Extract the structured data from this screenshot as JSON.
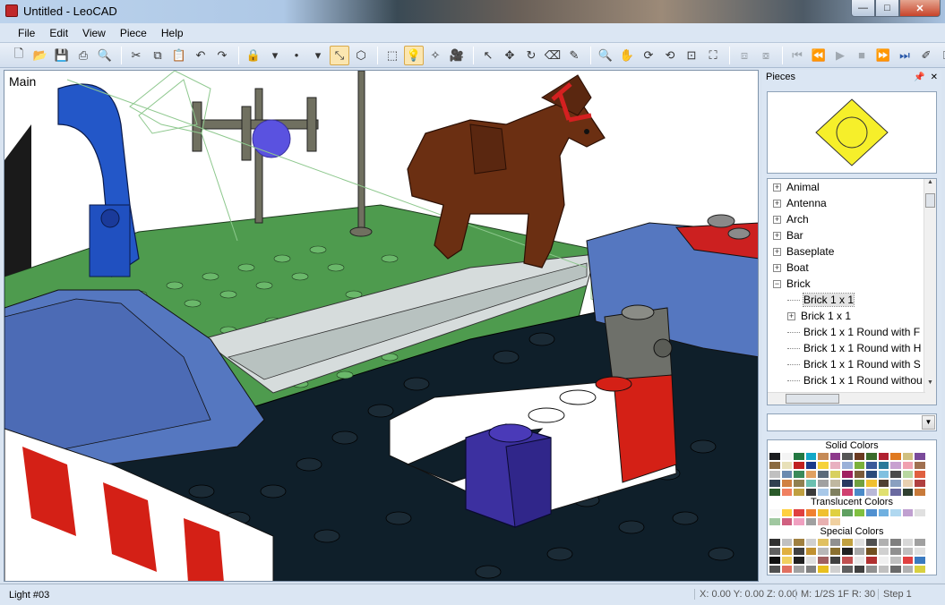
{
  "window": {
    "title": "Untitled - LeoCAD",
    "buttons": {
      "minimize": "—",
      "maximize": "□",
      "close": "✕"
    }
  },
  "menu": [
    {
      "label": "File"
    },
    {
      "label": "Edit"
    },
    {
      "label": "View"
    },
    {
      "label": "Piece"
    },
    {
      "label": "Help"
    }
  ],
  "toolbar": {
    "groups": [
      [
        {
          "icon": "new-file-icon",
          "glyph": "🗋"
        },
        {
          "icon": "open-folder-icon",
          "glyph": "📂"
        },
        {
          "icon": "save-icon",
          "glyph": "💾"
        },
        {
          "icon": "print-icon",
          "glyph": "⎙"
        },
        {
          "icon": "print-preview-icon",
          "glyph": "🔍"
        }
      ],
      [
        {
          "icon": "cut-icon",
          "glyph": "✂"
        },
        {
          "icon": "copy-icon",
          "glyph": "⧉"
        },
        {
          "icon": "paste-icon",
          "glyph": "📋"
        },
        {
          "icon": "undo-icon",
          "glyph": "↶"
        },
        {
          "icon": "redo-icon",
          "glyph": "↷"
        }
      ],
      [
        {
          "icon": "lock-icon",
          "glyph": "🔒"
        },
        {
          "icon": "dropdown-arrow-icon",
          "glyph": "▾"
        },
        {
          "icon": "snap-icon",
          "glyph": "•"
        },
        {
          "icon": "dropdown-arrow-icon",
          "glyph": "▾"
        },
        {
          "icon": "angle-snap-icon",
          "glyph": "⤡",
          "active": true
        },
        {
          "icon": "3d-box-icon",
          "glyph": "⬡"
        }
      ],
      [
        {
          "icon": "insert-brick-icon",
          "glyph": "⬚"
        },
        {
          "icon": "light-bulb-icon",
          "glyph": "💡",
          "active": true
        },
        {
          "icon": "spotlight-icon",
          "glyph": "✧"
        },
        {
          "icon": "camera-icon",
          "glyph": "🎥"
        }
      ],
      [
        {
          "icon": "select-arrow-icon",
          "glyph": "↖"
        },
        {
          "icon": "move-icon",
          "glyph": "✥"
        },
        {
          "icon": "rotate-icon",
          "glyph": "↻"
        },
        {
          "icon": "eraser-icon",
          "glyph": "⌫"
        },
        {
          "icon": "paint-icon",
          "glyph": "✎"
        }
      ],
      [
        {
          "icon": "zoom-icon",
          "glyph": "🔍"
        },
        {
          "icon": "pan-hand-icon",
          "glyph": "✋"
        },
        {
          "icon": "orbit-icon",
          "glyph": "⟳"
        },
        {
          "icon": "roll-icon",
          "glyph": "⟲"
        },
        {
          "icon": "zoom-region-icon",
          "glyph": "⊡"
        },
        {
          "icon": "zoom-extents-icon",
          "glyph": "⛶"
        }
      ],
      [
        {
          "icon": "group-icon",
          "glyph": "⧈",
          "dim": true
        },
        {
          "icon": "ungroup-icon",
          "glyph": "⧇",
          "dim": true
        }
      ],
      [
        {
          "icon": "first-frame-icon",
          "glyph": "⏮",
          "dim": true
        },
        {
          "icon": "prev-frame-icon",
          "glyph": "⏪",
          "dim": true
        },
        {
          "icon": "play-icon",
          "glyph": "▶",
          "dim": true
        },
        {
          "icon": "stop-icon",
          "glyph": "■",
          "dim": true
        },
        {
          "icon": "next-frame-icon",
          "glyph": "⏩",
          "blue": true
        },
        {
          "icon": "last-frame-icon",
          "glyph": "⏭",
          "blue": true
        },
        {
          "icon": "animation-icon",
          "glyph": "✐"
        },
        {
          "icon": "key-icon",
          "glyph": "⚿"
        }
      ]
    ]
  },
  "viewport": {
    "label": "Main"
  },
  "pieces_panel": {
    "title": "Pieces",
    "categories": [
      {
        "label": "Animal",
        "expanded": false
      },
      {
        "label": "Antenna",
        "expanded": false
      },
      {
        "label": "Arch",
        "expanded": false
      },
      {
        "label": "Bar",
        "expanded": false
      },
      {
        "label": "Baseplate",
        "expanded": false
      },
      {
        "label": "Boat",
        "expanded": false
      },
      {
        "label": "Brick",
        "expanded": true
      }
    ],
    "brick_children": [
      {
        "label": "Brick  1 x 1",
        "selected": true,
        "has_children": false
      },
      {
        "label": "Brick  1 x 1",
        "selected": false,
        "has_children": true
      },
      {
        "label": "Brick  1 x 1 Round with F",
        "selected": false,
        "has_children": false
      },
      {
        "label": "Brick  1 x 1 Round with H",
        "selected": false,
        "has_children": false
      },
      {
        "label": "Brick  1 x 1 Round with S",
        "selected": false,
        "has_children": false
      },
      {
        "label": "Brick  1 x 1 Round withou",
        "selected": false,
        "has_children": false
      }
    ],
    "color_dropdown_value": "",
    "palettes": {
      "solid_title": "Solid Colors",
      "solid": [
        "#1b1d1f",
        "#f4f4f4",
        "#237841",
        "#13a8c8",
        "#c58a56",
        "#8e3a8c",
        "#555555",
        "#6a3a20",
        "#3a6a2a",
        "#b02030",
        "#e07a20",
        "#d0c080",
        "#7a4a9a",
        "#8a6a40",
        "#e8e0b8",
        "#c02020",
        "#1a3a8a",
        "#f6d23a",
        "#e8b0c0",
        "#9ab0d8",
        "#7ab03a",
        "#3a5a9a",
        "#2a7a9a",
        "#c8a0d0",
        "#f0a0b0",
        "#a07050",
        "#c0c0c0",
        "#6a8ab0",
        "#3a8a5a",
        "#e0a060",
        "#5a6a7a",
        "#d8d060",
        "#a02060",
        "#7a5a3a",
        "#2a4a7a",
        "#80c0e0",
        "#4a4a4a",
        "#b8d8a0",
        "#e06040",
        "#304050",
        "#d08040",
        "#908050",
        "#6ac0b0",
        "#a0a0a0",
        "#c0b8a0",
        "#283860",
        "#70a040",
        "#f0c030",
        "#504030",
        "#8aa0c0",
        "#e8d0b0",
        "#b04040",
        "#2a5a2a",
        "#f08060",
        "#c0a040",
        "#3a3a3a",
        "#a8c8e8",
        "#808060",
        "#d04070",
        "#4a8ac8",
        "#b8b8d8",
        "#e0e070",
        "#6a6aa0",
        "#304030",
        "#c87a3a"
      ],
      "translucent_title": "Translucent Colors",
      "translucent": [
        "#f8f8f8",
        "#ffd040",
        "#e04040",
        "#f08030",
        "#f0c030",
        "#e0d040",
        "#60a060",
        "#80c040",
        "#5090d0",
        "#70b0e0",
        "#b0d8f0",
        "#c0a0d0",
        "#e0e0e0",
        "#a0c8a0",
        "#d06080",
        "#f0a0c0",
        "#a0a0a0",
        "#e8b0b0",
        "#f0d0a0"
      ],
      "special_title": "Special Colors",
      "special": [
        "#303030",
        "#c0c0c0",
        "#a08040",
        "#d0d0d0",
        "#e0c060",
        "#909090",
        "#c0a040",
        "#e0e0e0",
        "#505050",
        "#b0b0b0",
        "#808080",
        "#d8d8d8",
        "#a0a0a0",
        "#606060",
        "#e0b040",
        "#404040",
        "#c09030",
        "#b8b8b8",
        "#8a7030",
        "#202020",
        "#a8a8a8",
        "#705020",
        "#d0d0d0",
        "#909090",
        "#c0c0c0",
        "#e0e0e0",
        "#101010",
        "#f0d060",
        "#202020",
        "#e0e0e0",
        "#a06060",
        "#404040",
        "#c05050",
        "#e8e8e8",
        "#b03030",
        "#f0f0f0",
        "#c0c0c0",
        "#e04040",
        "#3a7ac0",
        "#505050",
        "#e07060",
        "#a0a0a0",
        "#808080",
        "#e8c020",
        "#d0d0d0",
        "#606060",
        "#404040",
        "#909090",
        "#c0c0c0",
        "#6a6a6a",
        "#b0b0b0",
        "#d8d040"
      ]
    }
  },
  "status": {
    "left": "Light #03",
    "coords": "X: 0.00 Y: 0.00 Z: 0.00",
    "snap": "M: 1/2S 1F R: 30",
    "step": "Step 1"
  },
  "colors": {
    "chrome": "#dbe6f3",
    "selection_highlight": "#fbe6b0"
  }
}
